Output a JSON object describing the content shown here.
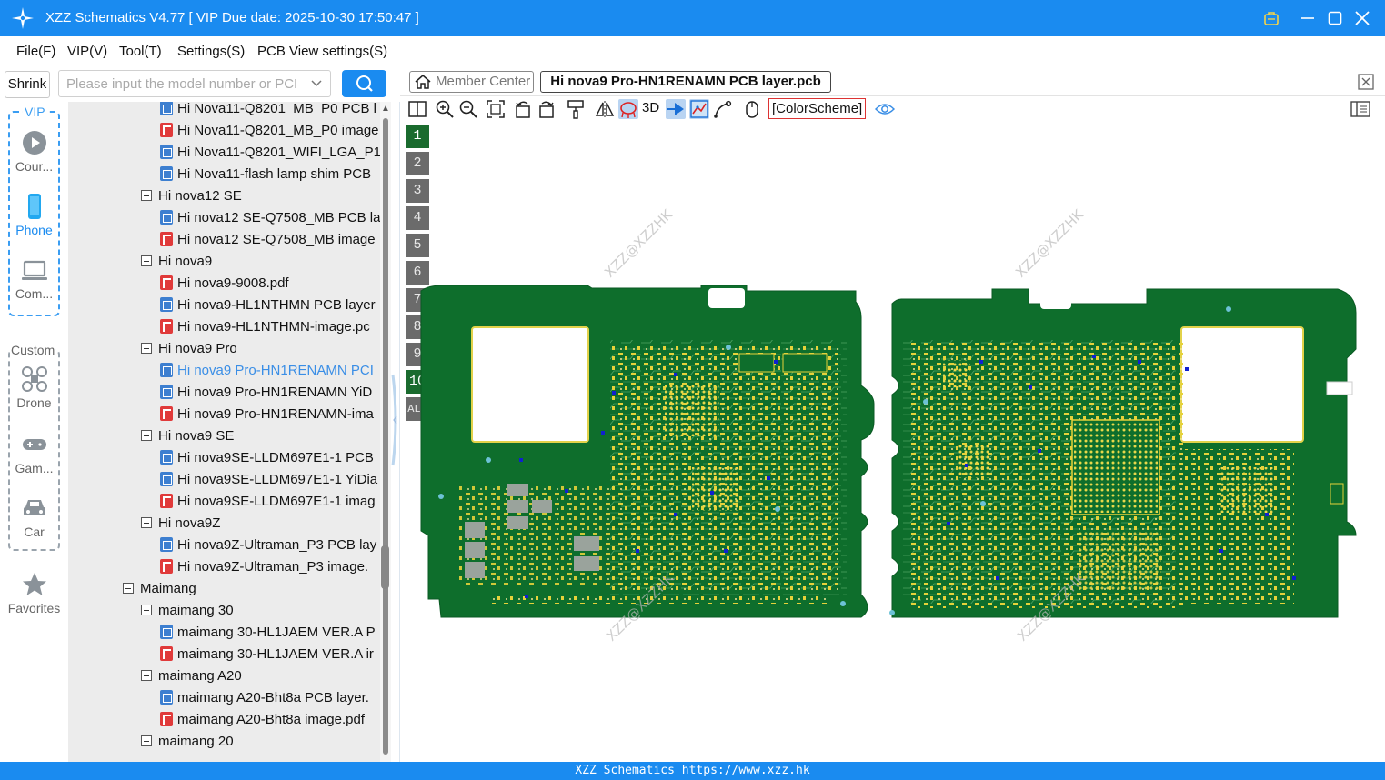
{
  "window": {
    "title": "XZZ Schematics V4.77 [ VIP Due date: 2025-10-30 17:50:47 ]"
  },
  "menu": [
    "File(F)",
    "VIP(V)",
    "Tool(T)",
    "Settings(S)",
    "PCB View settings(S)"
  ],
  "sidebar": {
    "shrink_label": "Shrink",
    "vip_label": "VIP",
    "custom_label": "Custom",
    "vip_items": [
      {
        "label": "Cour...",
        "icon": "play-circle-icon"
      },
      {
        "label": "Phone",
        "icon": "phone-icon",
        "active": true
      },
      {
        "label": "Com...",
        "icon": "laptop-icon"
      }
    ],
    "custom_items": [
      {
        "label": "Drone",
        "icon": "drone-icon"
      },
      {
        "label": "Gam...",
        "icon": "gamepad-icon"
      },
      {
        "label": "Car",
        "icon": "car-icon"
      }
    ],
    "favorites_label": "Favorites"
  },
  "search": {
    "placeholder": "Please input the model number or PCB"
  },
  "tree": [
    {
      "text": "Hi Nova11-Q8201_MB_P0 PCB l",
      "level": 2,
      "type": "pcb"
    },
    {
      "text": "Hi Nova11-Q8201_MB_P0 image",
      "level": 2,
      "type": "pdf"
    },
    {
      "text": "Hi Nova11-Q8201_WIFI_LGA_P1",
      "level": 2,
      "type": "pcb"
    },
    {
      "text": "Hi Nova11-flash lamp shim PCB",
      "level": 2,
      "type": "pcb"
    },
    {
      "text": "Hi nova12 SE",
      "level": 1,
      "type": "folder"
    },
    {
      "text": "Hi nova12 SE-Q7508_MB PCB la",
      "level": 2,
      "type": "pcb"
    },
    {
      "text": "Hi nova12 SE-Q7508_MB image",
      "level": 2,
      "type": "pdf"
    },
    {
      "text": "Hi nova9",
      "level": 1,
      "type": "folder"
    },
    {
      "text": "Hi nova9-9008.pdf",
      "level": 2,
      "type": "pdf"
    },
    {
      "text": "Hi nova9-HL1NTHMN PCB layer",
      "level": 2,
      "type": "pcb"
    },
    {
      "text": "Hi nova9-HL1NTHMN-image.pc",
      "level": 2,
      "type": "pdf"
    },
    {
      "text": "Hi nova9 Pro",
      "level": 1,
      "type": "folder"
    },
    {
      "text": "Hi nova9 Pro-HN1RENAMN PCI",
      "level": 2,
      "type": "pcb",
      "selected": true
    },
    {
      "text": "Hi nova9 Pro-HN1RENAMN YiD",
      "level": 2,
      "type": "pcb"
    },
    {
      "text": "Hi nova9 Pro-HN1RENAMN-ima",
      "level": 2,
      "type": "pdf"
    },
    {
      "text": "Hi nova9 SE",
      "level": 1,
      "type": "folder"
    },
    {
      "text": "Hi nova9SE-LLDM697E1-1 PCB",
      "level": 2,
      "type": "pcb"
    },
    {
      "text": "Hi nova9SE-LLDM697E1-1 YiDia",
      "level": 2,
      "type": "pcb"
    },
    {
      "text": "Hi nova9SE-LLDM697E1-1 imag",
      "level": 2,
      "type": "pdf"
    },
    {
      "text": "Hi nova9Z",
      "level": 1,
      "type": "folder"
    },
    {
      "text": "Hi nova9Z-Ultraman_P3 PCB lay",
      "level": 2,
      "type": "pcb"
    },
    {
      "text": "Hi nova9Z-Ultraman_P3 image.",
      "level": 2,
      "type": "pdf"
    },
    {
      "text": "Maimang",
      "level": 0,
      "type": "folder"
    },
    {
      "text": "maimang 30",
      "level": 1,
      "type": "folder"
    },
    {
      "text": "maimang 30-HL1JAEM VER.A P",
      "level": 2,
      "type": "pcb"
    },
    {
      "text": "maimang 30-HL1JAEM VER.A ir",
      "level": 2,
      "type": "pdf"
    },
    {
      "text": "maimang A20",
      "level": 1,
      "type": "folder"
    },
    {
      "text": "maimang A20-Bht8a PCB layer.",
      "level": 2,
      "type": "pcb"
    },
    {
      "text": "maimang A20-Bht8a image.pdf",
      "level": 2,
      "type": "pdf"
    },
    {
      "text": "maimang 20",
      "level": 1,
      "type": "folder"
    }
  ],
  "tabs": {
    "home_label": "Member Center",
    "active_label": "Hi nova9 Pro-HN1RENAMN PCB layer.pcb"
  },
  "toolbar": {
    "three_d_label": "3D",
    "color_scheme_label": "[ColorScheme]"
  },
  "layers": [
    "1",
    "2",
    "3",
    "4",
    "5",
    "6",
    "7",
    "8",
    "9",
    "10",
    "ALL"
  ],
  "active_layers": [
    "1",
    "10"
  ],
  "watermark": "XZZ@XZZHK",
  "status": "XZZ Schematics https://www.xzz.hk",
  "colors": {
    "accent": "#1a8bf0",
    "pcb_green": "#0e6e2c",
    "pad_yellow": "#e8d23a"
  }
}
